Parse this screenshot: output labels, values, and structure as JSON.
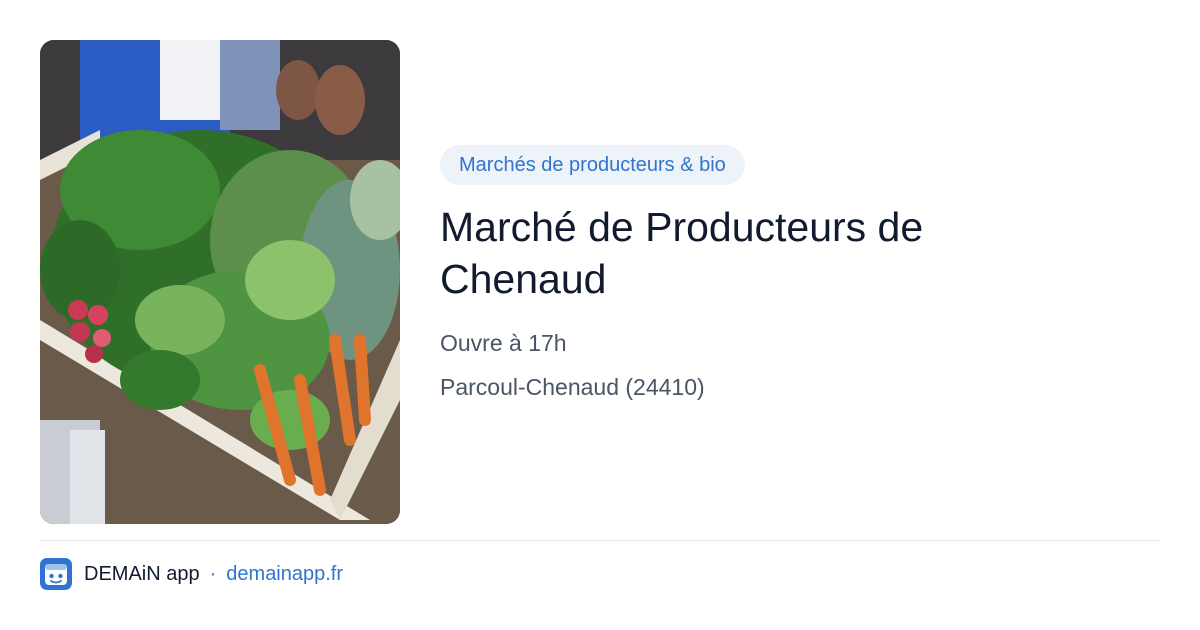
{
  "card": {
    "image_alt": "Cagette de légumes frais",
    "category": "Marchés de producteurs & bio",
    "title": "Marché de Producteurs de Chenaud",
    "hours": "Ouvre à 17h",
    "location": "Parcoul-Chenaud (24410)"
  },
  "footer": {
    "app_name": "DEMAiN app",
    "separator": "·",
    "domain": "demainapp.fr",
    "logo_icon": "demain-app-logo-icon"
  },
  "colors": {
    "accent": "#2f74d0",
    "pill_background": "#eef3fa",
    "title": "#111a2e",
    "muted_text": "#4a5565",
    "divider": "#dfe6ee"
  }
}
